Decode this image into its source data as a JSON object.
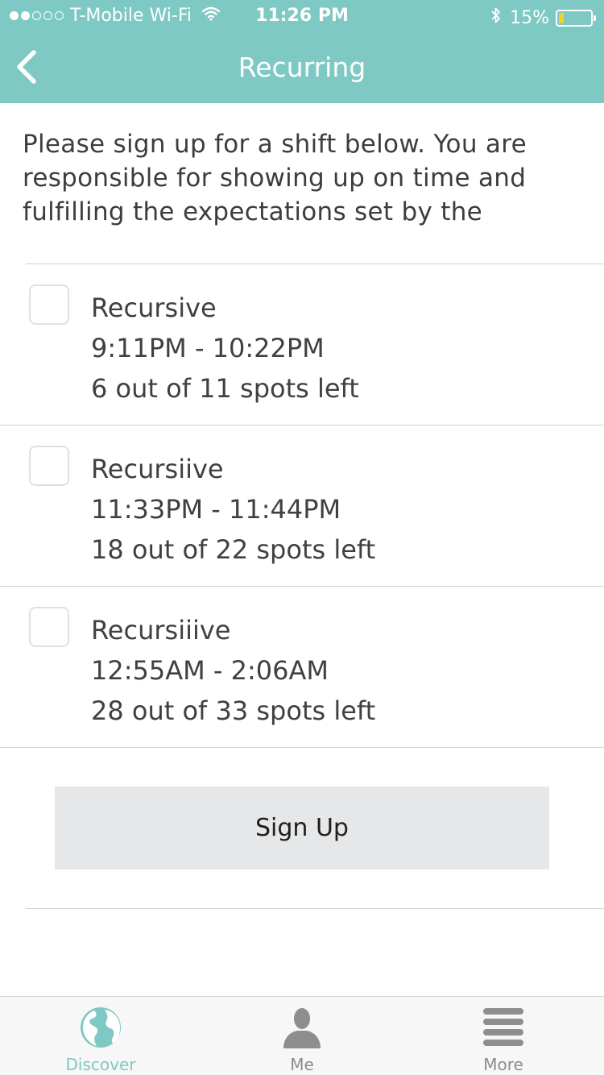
{
  "status_bar": {
    "carrier": "T-Mobile Wi-Fi",
    "time": "11:26 PM",
    "battery": "15%",
    "battery_level": 0.15,
    "signal_bars": 2
  },
  "nav": {
    "back_icon": "chevron-left-icon",
    "title": "Recurring"
  },
  "intro": {
    "text": "Please sign up for a shift below. You are responsible for showing up on time and fulfilling the expectations set by the"
  },
  "shifts": [
    {
      "name": "Recursive",
      "time": "9:11PM - 10:22PM",
      "spots": "6 out of 11 spots left",
      "checked": false
    },
    {
      "name": "Recursiive",
      "time": "11:33PM - 11:44PM",
      "spots": "18 out of 22 spots left",
      "checked": false
    },
    {
      "name": "Recursiiive",
      "time": "12:55AM - 2:06AM",
      "spots": "28 out of 33 spots left",
      "checked": false
    }
  ],
  "signup_button": {
    "label": "Sign Up"
  },
  "tabbar": {
    "tabs": [
      {
        "label": "Discover",
        "icon": "globe-icon",
        "active": true
      },
      {
        "label": "Me",
        "icon": "person-icon",
        "active": false
      },
      {
        "label": "More",
        "icon": "menu-icon",
        "active": false
      }
    ]
  },
  "colors": {
    "accent": "#7ec9c3",
    "button_bg": "#e6e7e8",
    "battery_fill": "#f2d12c"
  }
}
